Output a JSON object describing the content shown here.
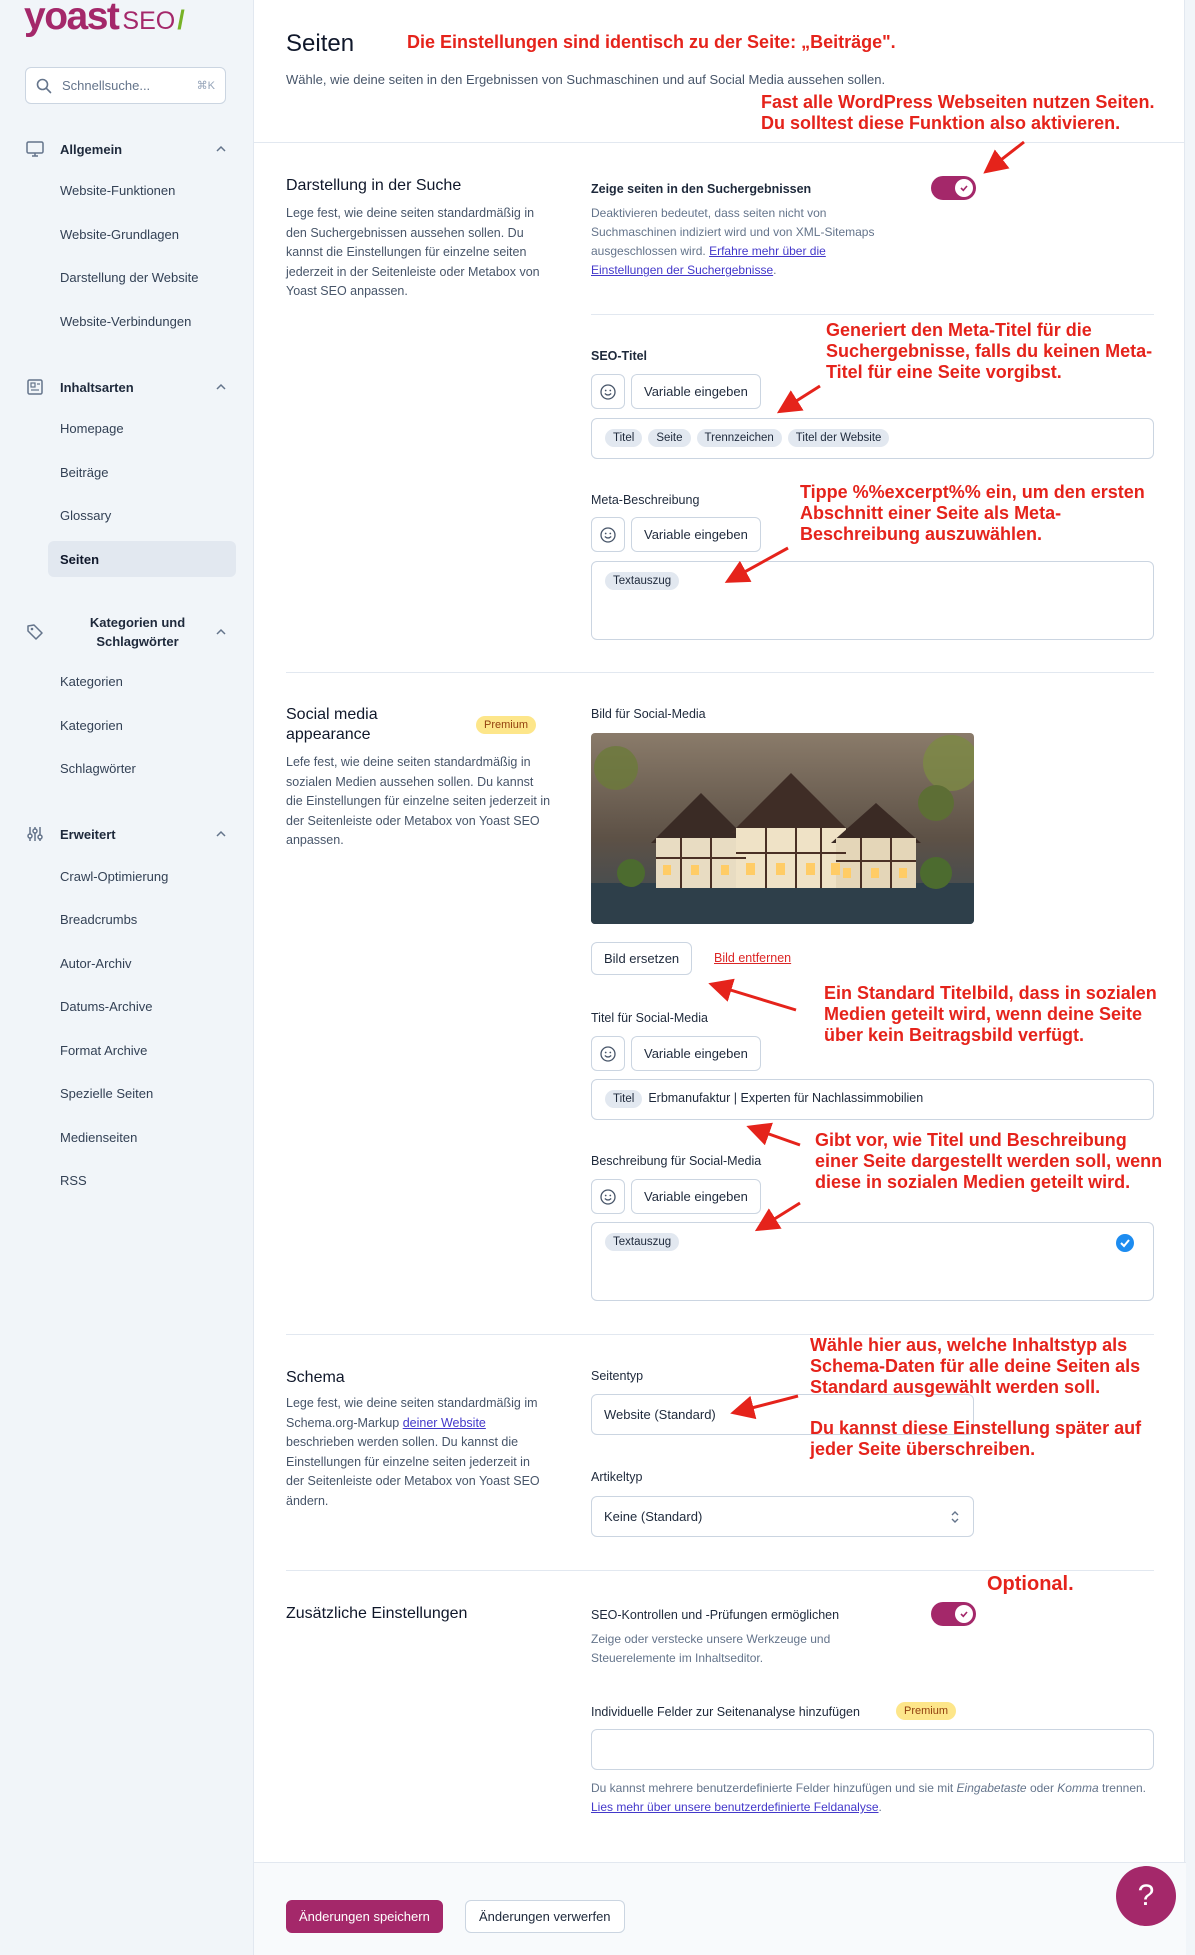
{
  "brand": {
    "logo_main": "yoast",
    "logo_suffix": "SEO",
    "logo_slash": "/",
    "primary": "#a4286a",
    "accent": "#77b227"
  },
  "sidebar": {
    "search": {
      "placeholder": "Schnellsuche...",
      "shortcut": "⌘K"
    },
    "groups": [
      {
        "label": "Allgemein",
        "icon": "desktop-icon",
        "items": [
          "Website-Funktionen",
          "Website-Grundlagen",
          "Darstellung der Website",
          "Website-Verbindungen"
        ]
      },
      {
        "label": "Inhaltsarten",
        "icon": "newspaper-icon",
        "items": [
          "Homepage",
          "Beiträge",
          "Glossary",
          "Seiten"
        ]
      },
      {
        "label": "Kategorien und Schlagwörter",
        "icon": "tag-icon",
        "items": [
          "Kategorien",
          "Kategorien",
          "Schlagwörter"
        ]
      },
      {
        "label": "Erweitert",
        "icon": "sliders-icon",
        "items": [
          "Crawl-Optimierung",
          "Breadcrumbs",
          "Autor-Archiv",
          "Datums-Archive",
          "Format Archive",
          "Spezielle Seiten",
          "Medienseiten",
          "RSS"
        ]
      }
    ],
    "active_item": "Seiten"
  },
  "page": {
    "title": "Seiten",
    "description": "Wähle, wie deine seiten in den Ergebnissen von Suchmaschinen und auf Social Media aussehen sollen."
  },
  "search_appearance": {
    "title": "Darstellung in der Suche",
    "description": "Lege fest, wie deine seiten standardmäßig in den Suchergebnissen aussehen sollen. Du kannst die Einstellungen für einzelne seiten jederzeit in der Seitenleiste oder Metabox von Yoast SEO anpassen.",
    "show_label": "Zeige seiten in den Suchergebnissen",
    "show_help": "Deaktivieren bedeutet, dass seiten nicht von Suchmaschinen indiziert wird und von XML-Sitemaps ausgeschlossen wird.",
    "show_help_link": "Erfahre mehr über die Einstellungen der Suchergebnisse",
    "show_help_end": ".",
    "show_enabled": true,
    "seo_title_label": "SEO-Titel",
    "seo_title_chips": [
      "Titel",
      "Seite",
      "Trennzeichen",
      "Titel der Website"
    ],
    "meta_desc_label": "Meta-Beschreibung",
    "meta_desc_chips": [
      "Textauszug"
    ],
    "insert_variable": "Variable eingeben"
  },
  "social": {
    "title": "Social media appearance",
    "premium": "Premium",
    "description": "Lefe fest, wie deine seiten standardmäßig in sozialen Medien aussehen sollen. Du kannst die Einstellungen für einzelne seiten jederzeit in der Seitenleiste oder Metabox von Yoast SEO anpassen.",
    "image_label": "Bild für Social-Media",
    "replace_image": "Bild ersetzen",
    "remove_image": "Bild entfernen",
    "title_label": "Titel für Social-Media",
    "title_chip": "Titel",
    "title_text": "Erbmanufaktur | Experten für Nachlassimmobilien",
    "desc_label": "Beschreibung für Social-Media",
    "desc_chip": "Textauszug",
    "insert_variable": "Variable eingeben"
  },
  "schema": {
    "title": "Schema",
    "desc_before": "Lege fest, wie deine seiten standardmäßig im Schema.org-Markup ",
    "desc_link": "deiner Website",
    "desc_after": " beschrieben werden sollen. Du kannst die Einstellungen für einzelne seiten jederzeit in der Seitenleiste oder Metabox von Yoast SEO ändern.",
    "page_type_label": "Seitentyp",
    "page_type_value": "Website (Standard)",
    "article_type_label": "Artikeltyp",
    "article_type_value": "Keine (Standard)"
  },
  "additional": {
    "title": "Zusätzliche Einstellungen",
    "controls_label": "SEO-Kontrollen und -Prüfungen ermöglichen",
    "controls_help": "Zeige oder verstecke unsere Werkzeuge und Steuerelemente im Inhaltseditor.",
    "controls_enabled": true,
    "custom_fields_label": "Individuelle Felder zur Seitenanalyse hinzufügen",
    "premium": "Premium",
    "custom_fields_help_1": "Du kannst mehrere benutzerdefinierte Felder hinzufügen und sie mit ",
    "custom_fields_help_em1": "Eingabetaste",
    "custom_fields_help_2": " oder ",
    "custom_fields_help_em2": "Komma",
    "custom_fields_help_3": " trennen.",
    "custom_fields_link": "Lies mehr über unsere benutzerdefinierte Feldanalyse",
    "custom_fields_link_end": "."
  },
  "footer": {
    "save": "Änderungen speichern",
    "discard": "Änderungen verwerfen",
    "help": "?"
  },
  "annotations": {
    "a1": "Die Einstellungen sind identisch zu der Seite: „Beiträge\".",
    "a2": "Fast alle WordPress Webseiten nutzen Seiten. Du solltest diese Funktion also aktivieren.",
    "a3": "Generiert den Meta-Titel für die Suchergebnisse, falls du keinen Meta-Titel für eine Seite vorgibst.",
    "a4": "Tippe %%excerpt%% ein, um den ersten Abschnitt einer Seite als Meta-Beschreibung auszuwählen.",
    "a5": "Ein Standard Titelbild, dass in sozialen Medien geteilt wird, wenn deine Seite über kein Beitragsbild verfügt.",
    "a6": "Gibt vor, wie Titel und Beschreibung einer Seite dargestellt werden soll, wenn diese in sozialen Medien geteilt wird.",
    "a7": "Wähle hier aus, welche Inhaltstyp als Schema-Daten für alle deine Seiten als Standard ausgewählt werden soll.",
    "a8": "Du kannst diese Einstellung später auf jeder Seite überschreiben.",
    "a9": "Optional."
  }
}
